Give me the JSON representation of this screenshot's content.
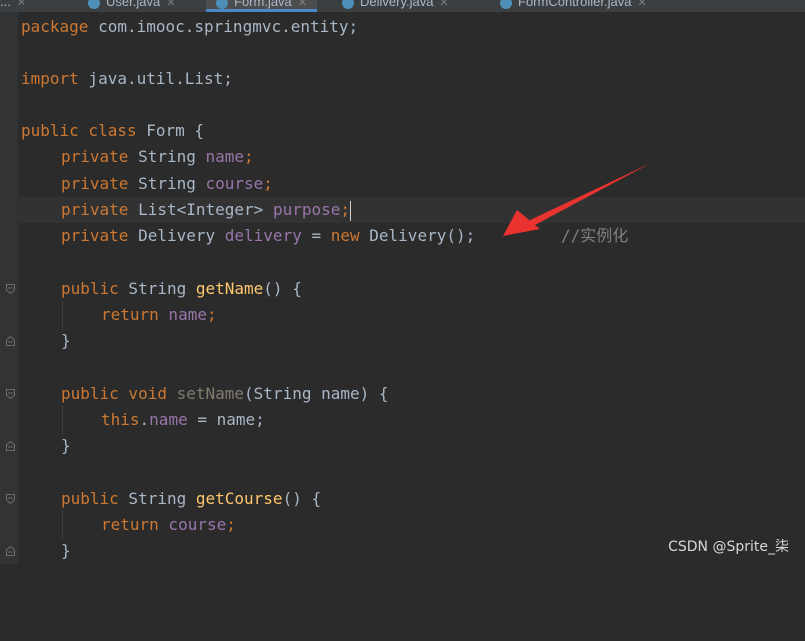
{
  "tabs": [
    {
      "label": "..."
    },
    {
      "label": "User.java"
    },
    {
      "label": "Form.java"
    },
    {
      "label": "Delivery.java"
    },
    {
      "label": "FormController.java"
    }
  ],
  "code": {
    "line1": {
      "kw": "package",
      "rest": " com.imooc.springmvc.entity;"
    },
    "line2": {
      "kw": "import",
      "rest": " java.util.List;"
    },
    "line3": {
      "kw": "public class",
      "rest": " Form {"
    },
    "line4": {
      "kw": "private",
      "type": " String ",
      "field": "name",
      "end": ";"
    },
    "line5": {
      "kw": "private",
      "type": " String ",
      "field": "course",
      "end": ";"
    },
    "line6": {
      "kw": "private",
      "type": " List<Integer> ",
      "field": "purpose",
      "end": ";"
    },
    "line7": {
      "kw": "private",
      "type": " Delivery ",
      "field": "delivery",
      "mid": " = ",
      "kw2": "new",
      "rest": " Delivery();",
      "comment": "//实例化"
    },
    "line8": {
      "kw": "public",
      "type": " String ",
      "fn": "getName",
      "rest": "() {"
    },
    "line9": {
      "kw": "return",
      "field": " name",
      "end": ";"
    },
    "line10": {
      "rest": "}"
    },
    "line11": {
      "kw": "public void",
      "fn": " setName",
      "rest": "(String name) {"
    },
    "line12": {
      "kw": "this",
      "dot": ".",
      "field": "name",
      "rest": " = name;"
    },
    "line13": {
      "rest": "}"
    },
    "line14": {
      "kw": "public",
      "type": " String ",
      "fn": "getCourse",
      "rest": "() {"
    },
    "line15": {
      "kw": "return",
      "field": " course",
      "end": ";"
    },
    "line16": {
      "rest": "}"
    }
  },
  "watermark": "CSDN @Sprite_柒",
  "colors": {
    "background": "#2b2b2b",
    "keyword": "#cc7832",
    "field": "#9876aa",
    "method": "#ffc66d",
    "comment": "#808080",
    "arrow": "#e8332e"
  }
}
